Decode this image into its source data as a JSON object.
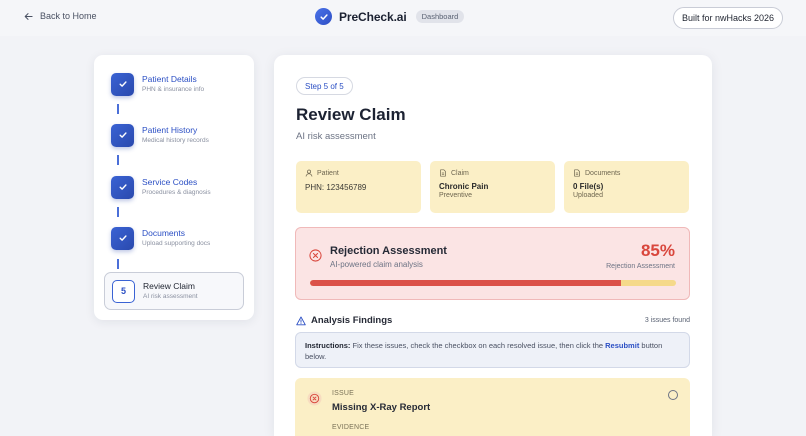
{
  "header": {
    "back_label": "Back to Home",
    "brand_name": "PreCheck.ai",
    "brand_badge": "Dashboard",
    "built_label": "Built for nwHacks 2026"
  },
  "sidebar": {
    "steps": [
      {
        "title": "Patient Details",
        "subtitle": "PHN & insurance info",
        "state": "done"
      },
      {
        "title": "Patient History",
        "subtitle": "Medical history records",
        "state": "done"
      },
      {
        "title": "Service Codes",
        "subtitle": "Procedures & diagnosis",
        "state": "done"
      },
      {
        "title": "Documents",
        "subtitle": "Upload supporting docs",
        "state": "done"
      },
      {
        "title": "Review Claim",
        "subtitle": "AI risk assessment",
        "state": "current",
        "number": "5"
      }
    ]
  },
  "main": {
    "step_pill": "Step 5 of 5",
    "title": "Review Claim",
    "subtitle": "AI risk assessment",
    "cards": {
      "patient": {
        "label": "Patient",
        "value": "PHN: 123456789"
      },
      "claim": {
        "label": "Claim",
        "value": "Chronic Pain",
        "sub": "Preventive"
      },
      "documents": {
        "label": "Documents",
        "value": "0 File(s)",
        "sub": "Uploaded"
      }
    },
    "rejection": {
      "title": "Rejection Assessment",
      "subtitle": "AI-powered claim analysis",
      "percent_label": "85%",
      "percent_value": 0.85,
      "caption": "Rejection Assessment"
    },
    "findings": {
      "title": "Analysis Findings",
      "count": "3 issues found"
    },
    "instructions": {
      "label": "Instructions:",
      "text_before": " Fix these issues, check the checkbox on each resolved issue, then click the ",
      "link": "Resubmit",
      "text_after": " button below."
    },
    "issue": {
      "label": "ISSUE",
      "title": "Missing X-Ray Report",
      "evidence_label": "EVIDENCE"
    }
  },
  "colors": {
    "accent": "#2b4fc4",
    "danger": "#d9473d",
    "warning_bg": "#fbefc6",
    "danger_bg": "#fbe4e4"
  }
}
